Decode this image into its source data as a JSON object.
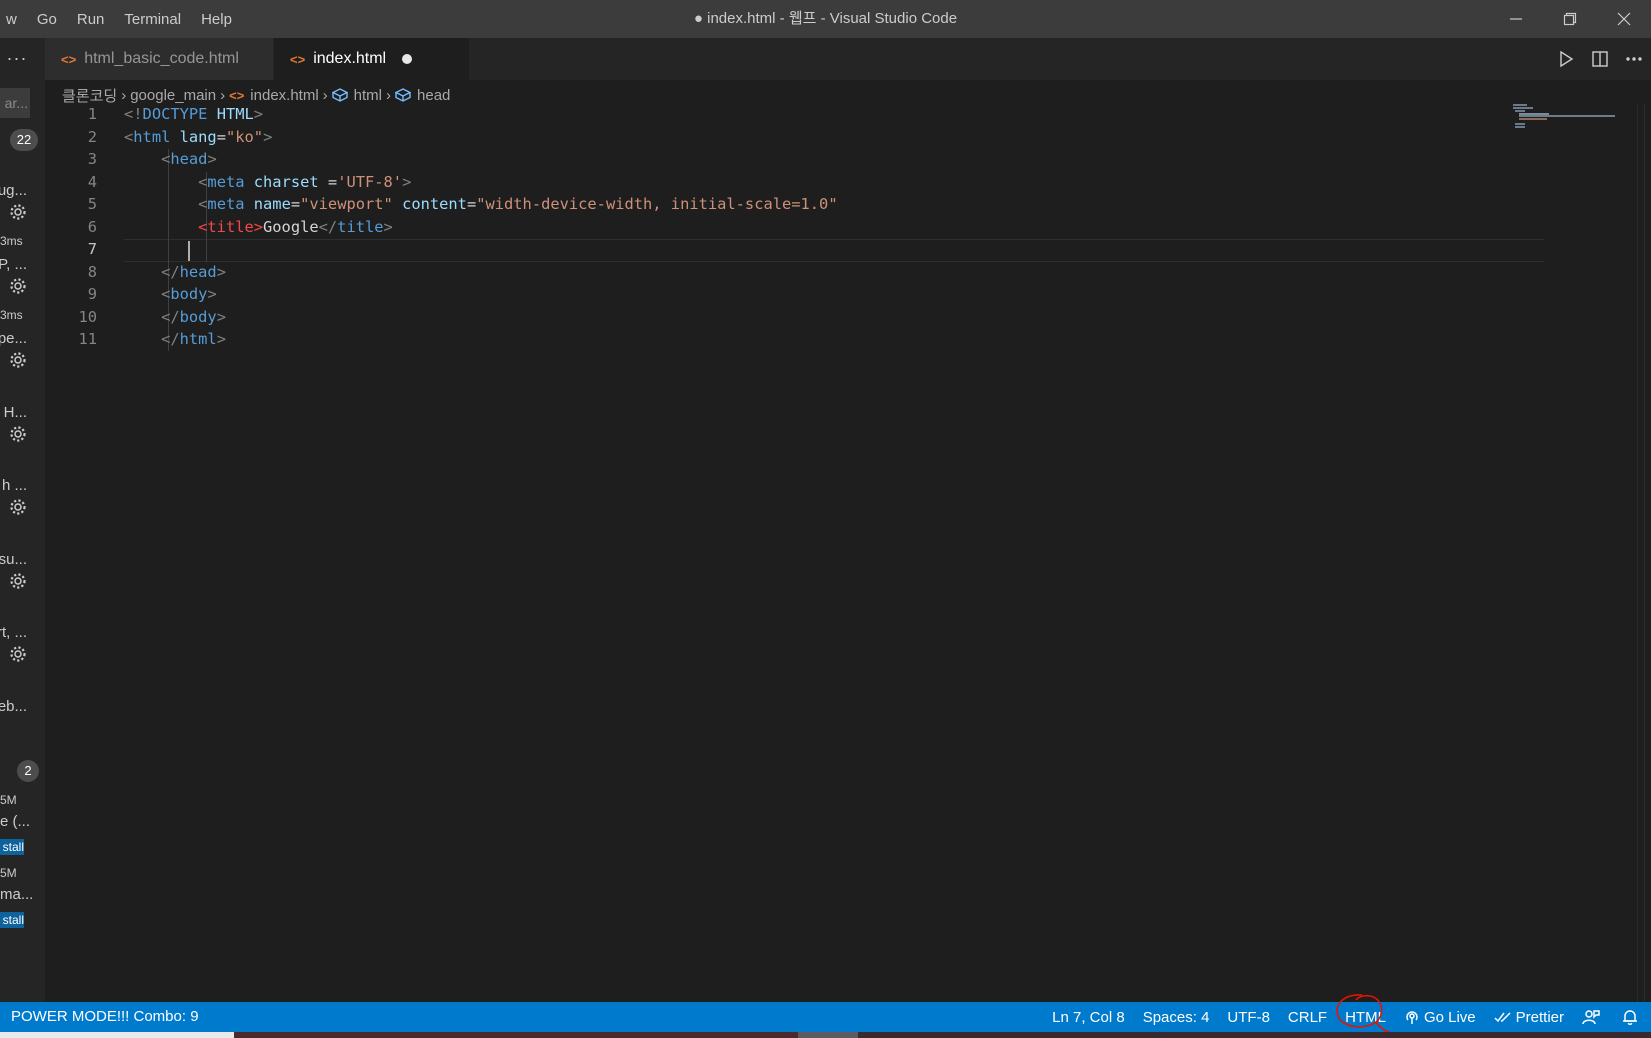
{
  "titlebar": {
    "menu": [
      "w",
      "Go",
      "Run",
      "Terminal",
      "Help"
    ],
    "title": "● index.html - 웹프 - Visual Studio Code"
  },
  "sidebar": {
    "more": "···",
    "search_fragment": "ar...",
    "badge_top": "22",
    "extensions": [
      {
        "name": "ug...",
        "meta": "3ms"
      },
      {
        "name": "P, ...",
        "meta": "3ms"
      },
      {
        "name": "pe...",
        "meta": ""
      },
      {
        "name": "g H...",
        "meta": ""
      },
      {
        "name": "h ...",
        "meta": ""
      },
      {
        "name": "su...",
        "meta": ""
      },
      {
        "name": "rt, ...",
        "meta": ""
      },
      {
        "name": "eb...",
        "meta": ""
      }
    ],
    "badge_bottom": "2",
    "recommended": [
      {
        "meta": "5M",
        "name": "e (...",
        "install": "stall"
      },
      {
        "meta": "5M",
        "name": "ma...",
        "install": "stall"
      }
    ]
  },
  "tabs": [
    {
      "label": "html_basic_code.html",
      "icon": "html-file-icon",
      "active": false
    },
    {
      "label": "index.html",
      "icon": "html-file-icon",
      "active": true,
      "dirty": true
    }
  ],
  "breadcrumbs": {
    "folder": "클론코딩",
    "subfolder": "google_main",
    "file": "index.html",
    "symbol1": "html",
    "symbol2": "head"
  },
  "editor": {
    "active_line": 7,
    "lines": [
      {
        "n": "1",
        "tokens": [
          [
            "pun",
            "<!"
          ],
          [
            "tag",
            "DOCTYPE "
          ],
          [
            "attr",
            "HTML"
          ],
          [
            "pun",
            ">"
          ]
        ]
      },
      {
        "n": "2",
        "tokens": [
          [
            "pun",
            "<"
          ],
          [
            "tag",
            "html "
          ],
          [
            "attr",
            "lang"
          ],
          [
            "txt",
            "="
          ],
          [
            "str",
            "\"ko\""
          ],
          [
            "pun",
            ">"
          ]
        ]
      },
      {
        "n": "3",
        "tokens": [
          [
            "txt",
            "    "
          ],
          [
            "pun",
            "<"
          ],
          [
            "tag",
            "head"
          ],
          [
            "pun",
            ">"
          ]
        ]
      },
      {
        "n": "4",
        "tokens": [
          [
            "txt",
            "        "
          ],
          [
            "pun",
            "<"
          ],
          [
            "tag",
            "meta "
          ],
          [
            "attr",
            "charset "
          ],
          [
            "txt",
            "="
          ],
          [
            "str",
            "'UTF-8'"
          ],
          [
            "pun",
            ">"
          ]
        ]
      },
      {
        "n": "5",
        "tokens": [
          [
            "txt",
            "        "
          ],
          [
            "pun",
            "<"
          ],
          [
            "tag",
            "meta "
          ],
          [
            "attr",
            "name"
          ],
          [
            "txt",
            "="
          ],
          [
            "str",
            "\"viewport\" "
          ],
          [
            "attr",
            "content"
          ],
          [
            "txt",
            "="
          ],
          [
            "str",
            "\"width-device-width, initial-scale=1.0\""
          ]
        ]
      },
      {
        "n": "6",
        "tokens": [
          [
            "txt",
            "        "
          ],
          [
            "err",
            "<title>"
          ],
          [
            "txt",
            "Google"
          ],
          [
            "pun",
            "</"
          ],
          [
            "tag",
            "title"
          ],
          [
            "pun",
            ">"
          ]
        ]
      },
      {
        "n": "7",
        "tokens": [
          [
            "txt",
            "        "
          ]
        ]
      },
      {
        "n": "8",
        "tokens": [
          [
            "txt",
            "    "
          ],
          [
            "pun",
            "</"
          ],
          [
            "tag",
            "head"
          ],
          [
            "pun",
            ">"
          ]
        ]
      },
      {
        "n": "9",
        "tokens": [
          [
            "txt",
            "    "
          ],
          [
            "pun",
            "<"
          ],
          [
            "tag",
            "body"
          ],
          [
            "pun",
            ">"
          ]
        ]
      },
      {
        "n": "10",
        "tokens": [
          [
            "txt",
            "    "
          ],
          [
            "pun",
            "</"
          ],
          [
            "tag",
            "body"
          ],
          [
            "pun",
            ">"
          ]
        ]
      },
      {
        "n": "11",
        "tokens": [
          [
            "txt",
            "    "
          ],
          [
            "pun",
            "</"
          ],
          [
            "tag",
            "html"
          ],
          [
            "pun",
            ">"
          ]
        ]
      }
    ]
  },
  "statusbar": {
    "left": "POWER MODE!!! Combo: 9",
    "position": "Ln 7, Col 8",
    "spaces": "Spaces: 4",
    "encoding": "UTF-8",
    "eol": "CRLF",
    "language": "HTML",
    "golive": "Go Live",
    "prettier": "Prettier"
  },
  "colors": {
    "statusbar": "#007acc",
    "titlebar": "#3c3c3c",
    "editor_bg": "#1e1e1e",
    "annotation": "#e51400"
  }
}
